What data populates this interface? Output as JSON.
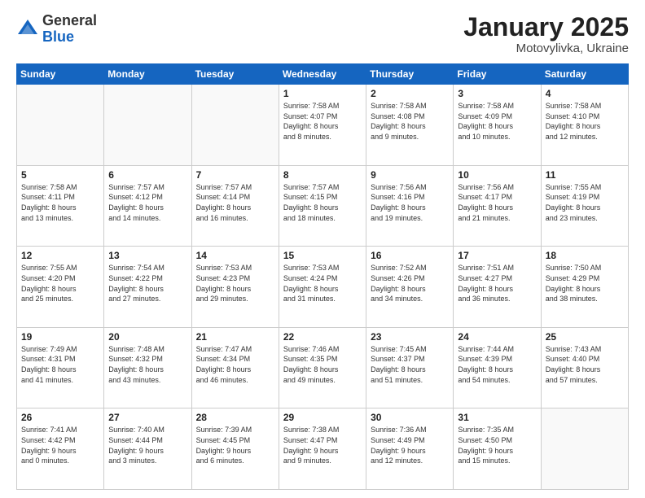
{
  "logo": {
    "general": "General",
    "blue": "Blue"
  },
  "header": {
    "month": "January 2025",
    "location": "Motovylivka, Ukraine"
  },
  "weekdays": [
    "Sunday",
    "Monday",
    "Tuesday",
    "Wednesday",
    "Thursday",
    "Friday",
    "Saturday"
  ],
  "weeks": [
    [
      {
        "day": "",
        "info": ""
      },
      {
        "day": "",
        "info": ""
      },
      {
        "day": "",
        "info": ""
      },
      {
        "day": "1",
        "info": "Sunrise: 7:58 AM\nSunset: 4:07 PM\nDaylight: 8 hours\nand 8 minutes."
      },
      {
        "day": "2",
        "info": "Sunrise: 7:58 AM\nSunset: 4:08 PM\nDaylight: 8 hours\nand 9 minutes."
      },
      {
        "day": "3",
        "info": "Sunrise: 7:58 AM\nSunset: 4:09 PM\nDaylight: 8 hours\nand 10 minutes."
      },
      {
        "day": "4",
        "info": "Sunrise: 7:58 AM\nSunset: 4:10 PM\nDaylight: 8 hours\nand 12 minutes."
      }
    ],
    [
      {
        "day": "5",
        "info": "Sunrise: 7:58 AM\nSunset: 4:11 PM\nDaylight: 8 hours\nand 13 minutes."
      },
      {
        "day": "6",
        "info": "Sunrise: 7:57 AM\nSunset: 4:12 PM\nDaylight: 8 hours\nand 14 minutes."
      },
      {
        "day": "7",
        "info": "Sunrise: 7:57 AM\nSunset: 4:14 PM\nDaylight: 8 hours\nand 16 minutes."
      },
      {
        "day": "8",
        "info": "Sunrise: 7:57 AM\nSunset: 4:15 PM\nDaylight: 8 hours\nand 18 minutes."
      },
      {
        "day": "9",
        "info": "Sunrise: 7:56 AM\nSunset: 4:16 PM\nDaylight: 8 hours\nand 19 minutes."
      },
      {
        "day": "10",
        "info": "Sunrise: 7:56 AM\nSunset: 4:17 PM\nDaylight: 8 hours\nand 21 minutes."
      },
      {
        "day": "11",
        "info": "Sunrise: 7:55 AM\nSunset: 4:19 PM\nDaylight: 8 hours\nand 23 minutes."
      }
    ],
    [
      {
        "day": "12",
        "info": "Sunrise: 7:55 AM\nSunset: 4:20 PM\nDaylight: 8 hours\nand 25 minutes."
      },
      {
        "day": "13",
        "info": "Sunrise: 7:54 AM\nSunset: 4:22 PM\nDaylight: 8 hours\nand 27 minutes."
      },
      {
        "day": "14",
        "info": "Sunrise: 7:53 AM\nSunset: 4:23 PM\nDaylight: 8 hours\nand 29 minutes."
      },
      {
        "day": "15",
        "info": "Sunrise: 7:53 AM\nSunset: 4:24 PM\nDaylight: 8 hours\nand 31 minutes."
      },
      {
        "day": "16",
        "info": "Sunrise: 7:52 AM\nSunset: 4:26 PM\nDaylight: 8 hours\nand 34 minutes."
      },
      {
        "day": "17",
        "info": "Sunrise: 7:51 AM\nSunset: 4:27 PM\nDaylight: 8 hours\nand 36 minutes."
      },
      {
        "day": "18",
        "info": "Sunrise: 7:50 AM\nSunset: 4:29 PM\nDaylight: 8 hours\nand 38 minutes."
      }
    ],
    [
      {
        "day": "19",
        "info": "Sunrise: 7:49 AM\nSunset: 4:31 PM\nDaylight: 8 hours\nand 41 minutes."
      },
      {
        "day": "20",
        "info": "Sunrise: 7:48 AM\nSunset: 4:32 PM\nDaylight: 8 hours\nand 43 minutes."
      },
      {
        "day": "21",
        "info": "Sunrise: 7:47 AM\nSunset: 4:34 PM\nDaylight: 8 hours\nand 46 minutes."
      },
      {
        "day": "22",
        "info": "Sunrise: 7:46 AM\nSunset: 4:35 PM\nDaylight: 8 hours\nand 49 minutes."
      },
      {
        "day": "23",
        "info": "Sunrise: 7:45 AM\nSunset: 4:37 PM\nDaylight: 8 hours\nand 51 minutes."
      },
      {
        "day": "24",
        "info": "Sunrise: 7:44 AM\nSunset: 4:39 PM\nDaylight: 8 hours\nand 54 minutes."
      },
      {
        "day": "25",
        "info": "Sunrise: 7:43 AM\nSunset: 4:40 PM\nDaylight: 8 hours\nand 57 minutes."
      }
    ],
    [
      {
        "day": "26",
        "info": "Sunrise: 7:41 AM\nSunset: 4:42 PM\nDaylight: 9 hours\nand 0 minutes."
      },
      {
        "day": "27",
        "info": "Sunrise: 7:40 AM\nSunset: 4:44 PM\nDaylight: 9 hours\nand 3 minutes."
      },
      {
        "day": "28",
        "info": "Sunrise: 7:39 AM\nSunset: 4:45 PM\nDaylight: 9 hours\nand 6 minutes."
      },
      {
        "day": "29",
        "info": "Sunrise: 7:38 AM\nSunset: 4:47 PM\nDaylight: 9 hours\nand 9 minutes."
      },
      {
        "day": "30",
        "info": "Sunrise: 7:36 AM\nSunset: 4:49 PM\nDaylight: 9 hours\nand 12 minutes."
      },
      {
        "day": "31",
        "info": "Sunrise: 7:35 AM\nSunset: 4:50 PM\nDaylight: 9 hours\nand 15 minutes."
      },
      {
        "day": "",
        "info": ""
      }
    ]
  ]
}
